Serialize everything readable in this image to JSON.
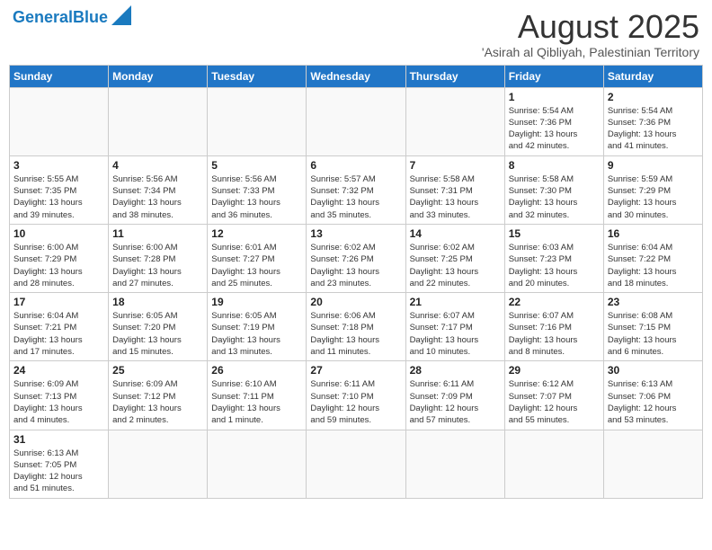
{
  "header": {
    "logo_general": "General",
    "logo_blue": "Blue",
    "month_year": "August 2025",
    "location": "'Asirah al Qibliyah, Palestinian Territory"
  },
  "weekdays": [
    "Sunday",
    "Monday",
    "Tuesday",
    "Wednesday",
    "Thursday",
    "Friday",
    "Saturday"
  ],
  "weeks": [
    [
      {
        "day": "",
        "info": ""
      },
      {
        "day": "",
        "info": ""
      },
      {
        "day": "",
        "info": ""
      },
      {
        "day": "",
        "info": ""
      },
      {
        "day": "",
        "info": ""
      },
      {
        "day": "1",
        "info": "Sunrise: 5:54 AM\nSunset: 7:36 PM\nDaylight: 13 hours\nand 42 minutes."
      },
      {
        "day": "2",
        "info": "Sunrise: 5:54 AM\nSunset: 7:36 PM\nDaylight: 13 hours\nand 41 minutes."
      }
    ],
    [
      {
        "day": "3",
        "info": "Sunrise: 5:55 AM\nSunset: 7:35 PM\nDaylight: 13 hours\nand 39 minutes."
      },
      {
        "day": "4",
        "info": "Sunrise: 5:56 AM\nSunset: 7:34 PM\nDaylight: 13 hours\nand 38 minutes."
      },
      {
        "day": "5",
        "info": "Sunrise: 5:56 AM\nSunset: 7:33 PM\nDaylight: 13 hours\nand 36 minutes."
      },
      {
        "day": "6",
        "info": "Sunrise: 5:57 AM\nSunset: 7:32 PM\nDaylight: 13 hours\nand 35 minutes."
      },
      {
        "day": "7",
        "info": "Sunrise: 5:58 AM\nSunset: 7:31 PM\nDaylight: 13 hours\nand 33 minutes."
      },
      {
        "day": "8",
        "info": "Sunrise: 5:58 AM\nSunset: 7:30 PM\nDaylight: 13 hours\nand 32 minutes."
      },
      {
        "day": "9",
        "info": "Sunrise: 5:59 AM\nSunset: 7:29 PM\nDaylight: 13 hours\nand 30 minutes."
      }
    ],
    [
      {
        "day": "10",
        "info": "Sunrise: 6:00 AM\nSunset: 7:29 PM\nDaylight: 13 hours\nand 28 minutes."
      },
      {
        "day": "11",
        "info": "Sunrise: 6:00 AM\nSunset: 7:28 PM\nDaylight: 13 hours\nand 27 minutes."
      },
      {
        "day": "12",
        "info": "Sunrise: 6:01 AM\nSunset: 7:27 PM\nDaylight: 13 hours\nand 25 minutes."
      },
      {
        "day": "13",
        "info": "Sunrise: 6:02 AM\nSunset: 7:26 PM\nDaylight: 13 hours\nand 23 minutes."
      },
      {
        "day": "14",
        "info": "Sunrise: 6:02 AM\nSunset: 7:25 PM\nDaylight: 13 hours\nand 22 minutes."
      },
      {
        "day": "15",
        "info": "Sunrise: 6:03 AM\nSunset: 7:23 PM\nDaylight: 13 hours\nand 20 minutes."
      },
      {
        "day": "16",
        "info": "Sunrise: 6:04 AM\nSunset: 7:22 PM\nDaylight: 13 hours\nand 18 minutes."
      }
    ],
    [
      {
        "day": "17",
        "info": "Sunrise: 6:04 AM\nSunset: 7:21 PM\nDaylight: 13 hours\nand 17 minutes."
      },
      {
        "day": "18",
        "info": "Sunrise: 6:05 AM\nSunset: 7:20 PM\nDaylight: 13 hours\nand 15 minutes."
      },
      {
        "day": "19",
        "info": "Sunrise: 6:05 AM\nSunset: 7:19 PM\nDaylight: 13 hours\nand 13 minutes."
      },
      {
        "day": "20",
        "info": "Sunrise: 6:06 AM\nSunset: 7:18 PM\nDaylight: 13 hours\nand 11 minutes."
      },
      {
        "day": "21",
        "info": "Sunrise: 6:07 AM\nSunset: 7:17 PM\nDaylight: 13 hours\nand 10 minutes."
      },
      {
        "day": "22",
        "info": "Sunrise: 6:07 AM\nSunset: 7:16 PM\nDaylight: 13 hours\nand 8 minutes."
      },
      {
        "day": "23",
        "info": "Sunrise: 6:08 AM\nSunset: 7:15 PM\nDaylight: 13 hours\nand 6 minutes."
      }
    ],
    [
      {
        "day": "24",
        "info": "Sunrise: 6:09 AM\nSunset: 7:13 PM\nDaylight: 13 hours\nand 4 minutes."
      },
      {
        "day": "25",
        "info": "Sunrise: 6:09 AM\nSunset: 7:12 PM\nDaylight: 13 hours\nand 2 minutes."
      },
      {
        "day": "26",
        "info": "Sunrise: 6:10 AM\nSunset: 7:11 PM\nDaylight: 13 hours\nand 1 minute."
      },
      {
        "day": "27",
        "info": "Sunrise: 6:11 AM\nSunset: 7:10 PM\nDaylight: 12 hours\nand 59 minutes."
      },
      {
        "day": "28",
        "info": "Sunrise: 6:11 AM\nSunset: 7:09 PM\nDaylight: 12 hours\nand 57 minutes."
      },
      {
        "day": "29",
        "info": "Sunrise: 6:12 AM\nSunset: 7:07 PM\nDaylight: 12 hours\nand 55 minutes."
      },
      {
        "day": "30",
        "info": "Sunrise: 6:13 AM\nSunset: 7:06 PM\nDaylight: 12 hours\nand 53 minutes."
      }
    ],
    [
      {
        "day": "31",
        "info": "Sunrise: 6:13 AM\nSunset: 7:05 PM\nDaylight: 12 hours\nand 51 minutes."
      },
      {
        "day": "",
        "info": ""
      },
      {
        "day": "",
        "info": ""
      },
      {
        "day": "",
        "info": ""
      },
      {
        "day": "",
        "info": ""
      },
      {
        "day": "",
        "info": ""
      },
      {
        "day": "",
        "info": ""
      }
    ]
  ]
}
